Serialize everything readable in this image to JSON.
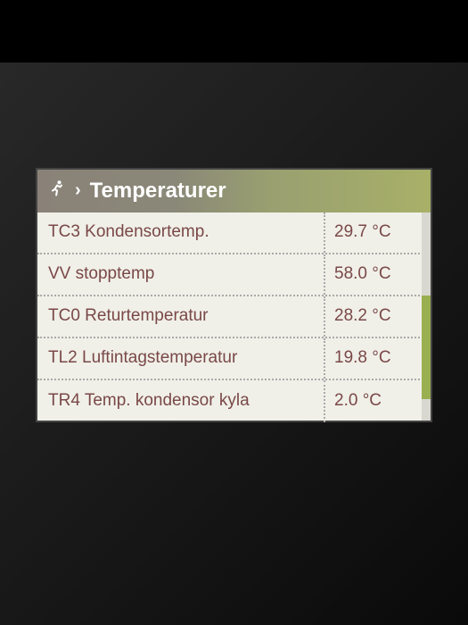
{
  "header": {
    "title": "Temperaturer"
  },
  "rows": [
    {
      "label": "TC3 Kondensortemp.",
      "value": "29.7 °C"
    },
    {
      "label": "VV stopptemp",
      "value": "58.0 °C"
    },
    {
      "label": "TC0 Returtemperatur",
      "value": "28.2 °C"
    },
    {
      "label": "TL2 Luftintagstemperatur",
      "value": "19.8 °C"
    },
    {
      "label": "TR4 Temp. kondensor kyla",
      "value": "2.0 °C"
    }
  ]
}
